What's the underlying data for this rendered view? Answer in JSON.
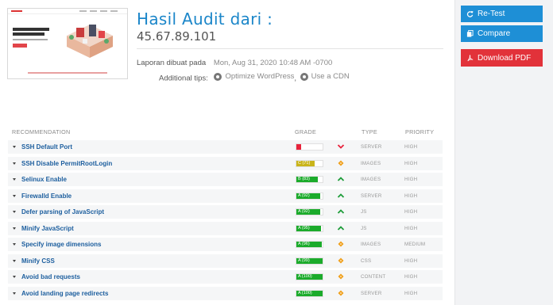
{
  "report": {
    "title": "Hasil Audit dari :",
    "ip": "45.67.89.101",
    "generated_label": "Laporan dibuat pada",
    "generated_value": "Mon, Aug 31, 2020 10:48 AM -0700",
    "tips_label": "Additional tips:",
    "tips": [
      {
        "label": "Optimize WordPress",
        "icon": "wordpress-icon"
      },
      {
        "label": "Use a CDN",
        "icon": "cdn-icon"
      }
    ]
  },
  "actions": {
    "retest_label": "Re-Test",
    "compare_label": "Compare",
    "pdf_label": "Download PDF"
  },
  "colors": {
    "title_blue": "#1b86c9",
    "button_blue": "#1e8fd6",
    "button_red": "#e2323a",
    "grade_red": "#e8233c",
    "grade_yellow": "#c9b41a",
    "grade_green": "#1bab2b",
    "trend_down": "#e8233c",
    "trend_up": "#1f9d3a",
    "trend_neutral": "#f0a01c"
  },
  "table": {
    "headers": {
      "recommendation": "RECOMMENDATION",
      "grade": "GRADE",
      "type": "TYPE",
      "priority": "PRIORITY"
    },
    "rows": [
      {
        "name": "SSH Default Port",
        "grade": "",
        "score": 0.18,
        "color": "red",
        "trend": "down",
        "type": "SERVER",
        "priority": "HIGH"
      },
      {
        "name": "SSH Disable PermitRootLogin",
        "grade": "C (71)",
        "score": 0.71,
        "color": "yellow",
        "trend": "neutral",
        "type": "IMAGES",
        "priority": "HIGH"
      },
      {
        "name": "Selinux Enable",
        "grade": "B (83)",
        "score": 0.83,
        "color": "green",
        "trend": "up",
        "type": "IMAGES",
        "priority": "HIGH"
      },
      {
        "name": "Firewalld Enable",
        "grade": "A (92)",
        "score": 0.92,
        "color": "green",
        "trend": "up",
        "type": "SERVER",
        "priority": "HIGH"
      },
      {
        "name": "Defer parsing of JavaScript",
        "grade": "A (92)",
        "score": 0.92,
        "color": "green",
        "trend": "up",
        "type": "JS",
        "priority": "HIGH"
      },
      {
        "name": "Minify JavaScript",
        "grade": "A (95)",
        "score": 0.95,
        "color": "green",
        "trend": "up",
        "type": "JS",
        "priority": "HIGH"
      },
      {
        "name": "Specify image dimensions",
        "grade": "A (96)",
        "score": 0.96,
        "color": "green",
        "trend": "neutral",
        "type": "IMAGES",
        "priority": "MEDIUM"
      },
      {
        "name": "Minify CSS",
        "grade": "A (99)",
        "score": 0.99,
        "color": "green",
        "trend": "neutral",
        "type": "CSS",
        "priority": "HIGH"
      },
      {
        "name": "Avoid bad requests",
        "grade": "A (100)",
        "score": 1.0,
        "color": "green",
        "trend": "neutral",
        "type": "CONTENT",
        "priority": "HIGH"
      },
      {
        "name": "Avoid landing page redirects",
        "grade": "A (100)",
        "score": 1.0,
        "color": "green",
        "trend": "neutral",
        "type": "SERVER",
        "priority": "HIGH"
      }
    ]
  }
}
